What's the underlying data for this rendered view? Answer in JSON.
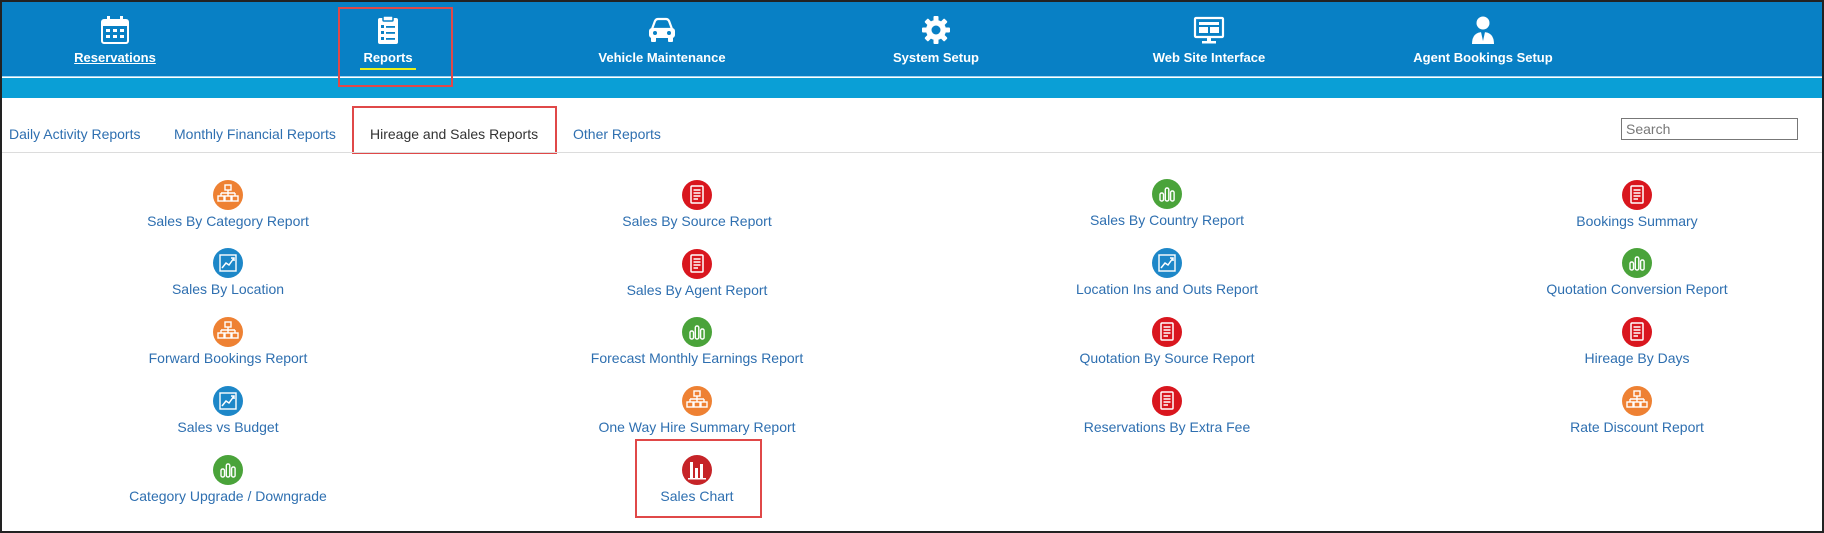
{
  "nav": {
    "items": [
      {
        "label": "Reservations",
        "icon": "calendar-icon"
      },
      {
        "label": "Reports",
        "icon": "clipboard-list-icon"
      },
      {
        "label": "Vehicle Maintenance",
        "icon": "car-icon"
      },
      {
        "label": "System Setup",
        "icon": "gear-icon"
      },
      {
        "label": "Web Site Interface",
        "icon": "monitor-icon"
      },
      {
        "label": "Agent Bookings Setup",
        "icon": "agent-icon"
      }
    ],
    "active": "Reports"
  },
  "tabs": {
    "items": [
      {
        "label": "Daily Activity Reports"
      },
      {
        "label": "Monthly Financial Reports"
      },
      {
        "label": "Hireage and Sales Reports"
      },
      {
        "label": "Other Reports"
      }
    ],
    "active": "Hireage and Sales Reports"
  },
  "search": {
    "placeholder": "Search"
  },
  "colors": {
    "orange": "#ee8133",
    "red": "#d9161e",
    "green": "#4aa33a",
    "blue": "#1d87c8",
    "nav": "#0880c5"
  },
  "reports": {
    "col1": [
      {
        "label": "Sales By Category Report",
        "icon": "hierarchy-icon",
        "color": "orange"
      },
      {
        "label": "Sales By Location",
        "icon": "trend-chart-icon",
        "color": "blue"
      },
      {
        "label": "Forward Bookings Report",
        "icon": "hierarchy-icon",
        "color": "orange"
      },
      {
        "label": "Sales vs Budget",
        "icon": "trend-chart-icon",
        "color": "blue"
      },
      {
        "label": "Category Upgrade / Downgrade",
        "icon": "bar-chart-icon",
        "color": "green"
      }
    ],
    "col2": [
      {
        "label": "Sales By Source Report",
        "icon": "document-icon",
        "color": "red"
      },
      {
        "label": "Sales By Agent Report",
        "icon": "document-icon",
        "color": "red"
      },
      {
        "label": "Forecast Monthly Earnings Report",
        "icon": "bar-chart-icon",
        "color": "green"
      },
      {
        "label": "One Way Hire Summary Report",
        "icon": "hierarchy-icon",
        "color": "orange"
      },
      {
        "label": "Sales Chart",
        "icon": "sales-chart-icon",
        "color": "red"
      }
    ],
    "col3": [
      {
        "label": "Sales By Country Report",
        "icon": "bar-chart-icon",
        "color": "green"
      },
      {
        "label": "Location Ins and Outs Report",
        "icon": "trend-chart-icon",
        "color": "blue"
      },
      {
        "label": "Quotation By Source Report",
        "icon": "document-icon",
        "color": "red"
      },
      {
        "label": "Reservations By Extra Fee",
        "icon": "document-icon",
        "color": "red"
      }
    ],
    "col4": [
      {
        "label": "Bookings Summary",
        "icon": "document-icon",
        "color": "red"
      },
      {
        "label": "Quotation Conversion Report",
        "icon": "bar-chart-icon",
        "color": "green"
      },
      {
        "label": "Hireage By Days",
        "icon": "document-icon",
        "color": "red"
      },
      {
        "label": "Rate Discount Report",
        "icon": "hierarchy-icon",
        "color": "orange"
      }
    ]
  }
}
